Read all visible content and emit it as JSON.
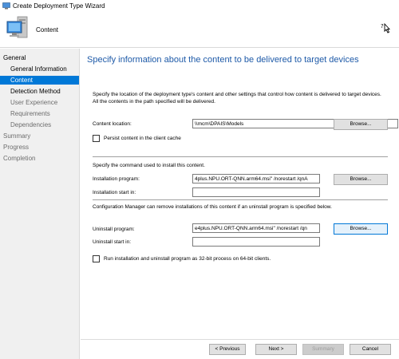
{
  "window": {
    "title": "Create Deployment Type Wizard"
  },
  "banner": {
    "heading": "Content"
  },
  "sidebar": {
    "items": [
      {
        "label": "General"
      },
      {
        "label": "General Information"
      },
      {
        "label": "Content"
      },
      {
        "label": "Detection Method"
      },
      {
        "label": "User Experience"
      },
      {
        "label": "Requirements"
      },
      {
        "label": "Dependencies"
      },
      {
        "label": "Summary"
      },
      {
        "label": "Progress"
      },
      {
        "label": "Completion"
      }
    ]
  },
  "main": {
    "title": "Specify information about the content to be delivered to target devices",
    "description": "Specify the location of the deployment type's content and other settings that control how content is delivered to target devices. All the contents in the path specified will be delivered.",
    "content_location_label": "Content location:",
    "content_location_value": "\\\\mcm\\DPAIS\\Models",
    "browse_label": "Browse...",
    "persist_label": "Persist content in the client cache",
    "install_section": "Specify the command used to install this content.",
    "install_program_label": "Installation program:",
    "install_program_value": "4plus.NPU.ORT-QNN.arm64.msi\" /norestart /qnA",
    "install_start_label": "Installation start in:",
    "install_start_value": "",
    "uninstall_section": "Configuration Manager can remove installations of this content if an uninstall program is specified below.",
    "uninstall_program_label": "Uninstall program:",
    "uninstall_program_value": "e4plus.NPU.ORT-QNN.arm64.msi\" /norestart /qn",
    "uninstall_start_label": "Uninstall start in:",
    "uninstall_start_value": "",
    "run32_label": "Run installation and uninstall program as 32-bit process on 64-bit clients."
  },
  "footer": {
    "previous_label": "< Previous",
    "next_label": "Next >",
    "summary_label": "Summary",
    "cancel_label": "Cancel"
  },
  "colors": {
    "accent": "#0078d7",
    "title_blue": "#1e5aa8",
    "sidebar_bg": "#f0f0f0"
  },
  "icons": {
    "app": "computer-icon",
    "banner": "computer-icon",
    "help": "help-pointer-icon"
  }
}
